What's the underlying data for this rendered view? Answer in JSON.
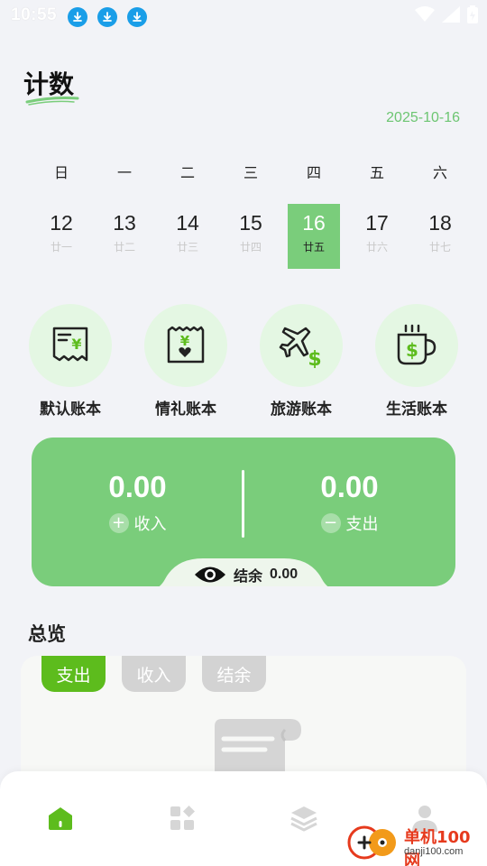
{
  "status_bar": {
    "time": "10:55",
    "download_icons": [
      "download-icon",
      "download-icon",
      "download-icon"
    ],
    "system_icons": [
      "wifi-icon",
      "signal-icon",
      "battery-icon"
    ]
  },
  "page_title": "计数",
  "selected_date": "2025-10-16",
  "calendar": {
    "weekdays": [
      "日",
      "一",
      "二",
      "三",
      "四",
      "五",
      "六"
    ],
    "days": [
      {
        "day": "12",
        "lunar": "廿一"
      },
      {
        "day": "13",
        "lunar": "廿二"
      },
      {
        "day": "14",
        "lunar": "廿三"
      },
      {
        "day": "15",
        "lunar": "廿四"
      },
      {
        "day": "16",
        "lunar": "廿五",
        "selected": true
      },
      {
        "day": "17",
        "lunar": "廿六"
      },
      {
        "day": "18",
        "lunar": "廿七"
      }
    ]
  },
  "books": [
    {
      "label": "默认账本",
      "icon": "receipt-yen-icon"
    },
    {
      "label": "情礼账本",
      "icon": "gift-receipt-icon"
    },
    {
      "label": "旅游账本",
      "icon": "airplane-dollar-icon"
    },
    {
      "label": "生活账本",
      "icon": "coffee-cup-dollar-icon"
    }
  ],
  "summary": {
    "income_amount": "0.00",
    "income_label": "收入",
    "expense_amount": "0.00",
    "expense_label": "支出",
    "balance_label": "结余",
    "balance_amount": "0.00",
    "accent": "#7acd7b"
  },
  "overview": {
    "title": "总览",
    "tabs": [
      {
        "label": "支出",
        "active": true
      },
      {
        "label": "收入",
        "active": false
      },
      {
        "label": "结余",
        "active": false
      }
    ]
  },
  "bottom_nav": {
    "items": [
      "home-icon",
      "apps-icon",
      "layers-icon",
      "profile-icon"
    ]
  },
  "watermark": {
    "name": "单机100网",
    "url": "danji100.com"
  }
}
